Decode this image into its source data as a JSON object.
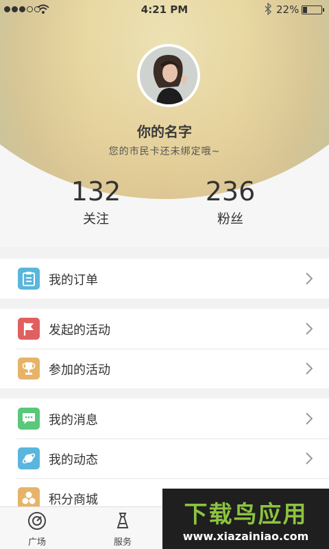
{
  "status_bar": {
    "time": "4:21 PM",
    "battery_percent": "22%",
    "battery_level": 0.22,
    "signal_dots_filled": 3,
    "icons": [
      "signal-icon",
      "wifi-icon",
      "bluetooth-icon",
      "battery-icon"
    ]
  },
  "colors": {
    "hero_gradient": [
      "#f3f1c6",
      "#ecdfa8",
      "#b8c3a0",
      "#6f9aa0"
    ],
    "order_icon": "#5ab6dc",
    "flag_icon": "#e06060",
    "trophy_icon": "#e6b469",
    "message_icon": "#58c87a",
    "planet_icon": "#5ab6dc",
    "coins_icon": "#e6b469"
  },
  "profile": {
    "name": "你的名字",
    "subtitle": "您的市民卡还未绑定哦~",
    "stats": [
      {
        "value": "132",
        "label": "关注"
      },
      {
        "value": "236",
        "label": "粉丝"
      }
    ]
  },
  "menu_groups": [
    {
      "items": [
        {
          "label": "我的订单",
          "icon": "clipboard-icon"
        }
      ]
    },
    {
      "items": [
        {
          "label": "发起的活动",
          "icon": "flag-icon"
        },
        {
          "label": "参加的活动",
          "icon": "trophy-icon"
        }
      ]
    },
    {
      "items": [
        {
          "label": "我的消息",
          "icon": "message-icon"
        },
        {
          "label": "我的动态",
          "icon": "planet-icon"
        },
        {
          "label": "积分商城",
          "icon": "coins-icon"
        }
      ]
    }
  ],
  "tabbar": {
    "tabs": [
      {
        "label": "广场",
        "icon": "compass-icon"
      },
      {
        "label": "服务",
        "icon": "service-icon"
      }
    ]
  },
  "watermark": {
    "title": "下载鸟应用",
    "url": "www.xiazainiao.com"
  }
}
